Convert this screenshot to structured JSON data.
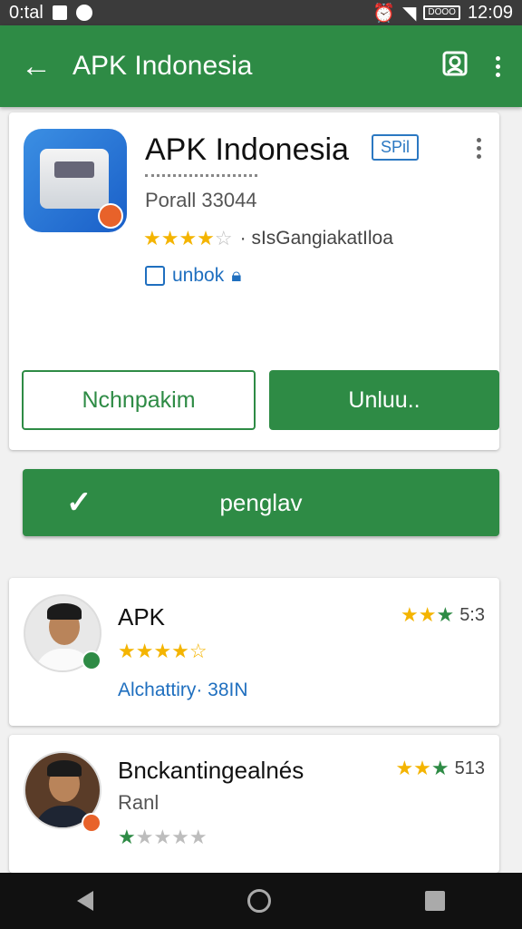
{
  "status": {
    "carrier": "0:tal",
    "time": "12:09",
    "battery": "DOOO"
  },
  "appbar": {
    "title": "APK Indonesia",
    "back_icon": "arrow-left-icon",
    "account_icon": "account-box-icon",
    "menu_icon": "more-vert-icon"
  },
  "app": {
    "name": "APK Indonesia",
    "tag": "SPil",
    "subtitle": "Porall 33044",
    "rating_text": "· sIsGangiakatIloa",
    "rating_stars": 4,
    "link_text": "unbok",
    "install_label": "Nchnpakim",
    "open_label": "Unluu.."
  },
  "main_action": {
    "label": "penglav",
    "icon": "check-icon"
  },
  "reviews": [
    {
      "name": "APK",
      "stars": 4,
      "score_stars": 3,
      "score": "5:3",
      "meta": "Alchattiry· 38IN",
      "sub": ""
    },
    {
      "name": "Bnckantingealnés",
      "stars": 1,
      "score_stars": 3,
      "score": "513",
      "meta": "",
      "sub": "Ranl"
    }
  ],
  "colors": {
    "primary": "#2e8b45",
    "accent_blue": "#1f6fbf",
    "star": "#f4b400"
  }
}
